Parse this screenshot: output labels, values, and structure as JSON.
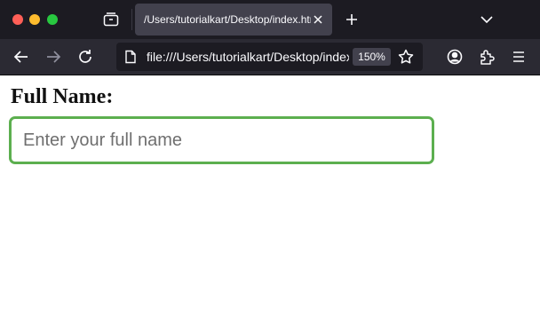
{
  "browser": {
    "tab": {
      "title": "/Users/tutorialkart/Desktop/index.html"
    },
    "address_bar": {
      "url": "file:///Users/tutorialkart/Desktop/index.html"
    },
    "zoom_level": "150%",
    "colors": {
      "titlebar": "#1c1b22",
      "toolbar": "#2b2a33",
      "active_tab": "#42414d"
    },
    "icons": [
      "tab-manager-icon",
      "close-icon",
      "plus-icon",
      "chevron-down-icon",
      "back-arrow-icon",
      "forward-arrow-icon",
      "reload-icon",
      "page-icon",
      "star-icon",
      "account-icon",
      "extensions-icon",
      "menu-icon"
    ]
  },
  "page": {
    "label": "Full Name:",
    "input": {
      "placeholder": "Enter your full name",
      "value": "",
      "border_color": "#5caf4f"
    }
  }
}
